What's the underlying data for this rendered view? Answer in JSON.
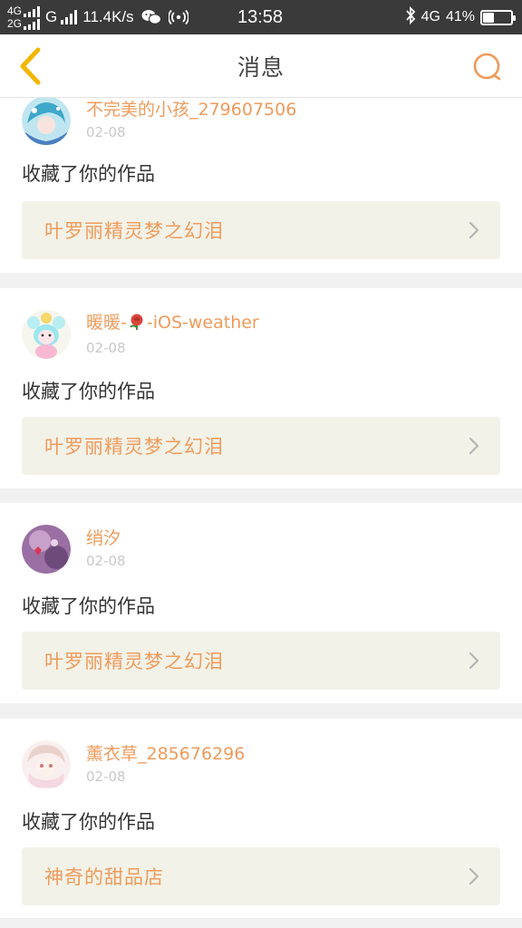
{
  "status_bar": {
    "net_top": "4G",
    "net_bottom": "2G",
    "net_g": "G",
    "speed": "11.4K/s",
    "time": "13:58",
    "net_right": "4G",
    "battery_percent": "41%",
    "battery_level": 0.41
  },
  "navbar": {
    "title": "消息"
  },
  "messages": [
    {
      "username": "不完美的小孩_279607506",
      "date": "02-08",
      "action": "收藏了你的作品",
      "work_title": "叶罗丽精灵梦之幻泪"
    },
    {
      "username_pre": "暖暖-",
      "username_post": "-iOS-weather",
      "date": "02-08",
      "action": "收藏了你的作品",
      "work_title": "叶罗丽精灵梦之幻泪"
    },
    {
      "username": "绡汐",
      "date": "02-08",
      "action": "收藏了你的作品",
      "work_title": "叶罗丽精灵梦之幻泪"
    },
    {
      "username": "薰衣草_285676296",
      "date": "02-08",
      "action": "收藏了你的作品",
      "work_title": "神奇的甜品店"
    }
  ],
  "colors": {
    "accent": "#ef9b5b",
    "card_bg": "#ffffff",
    "work_bg": "#f3f2e8",
    "separator": "#f1f1f1"
  }
}
